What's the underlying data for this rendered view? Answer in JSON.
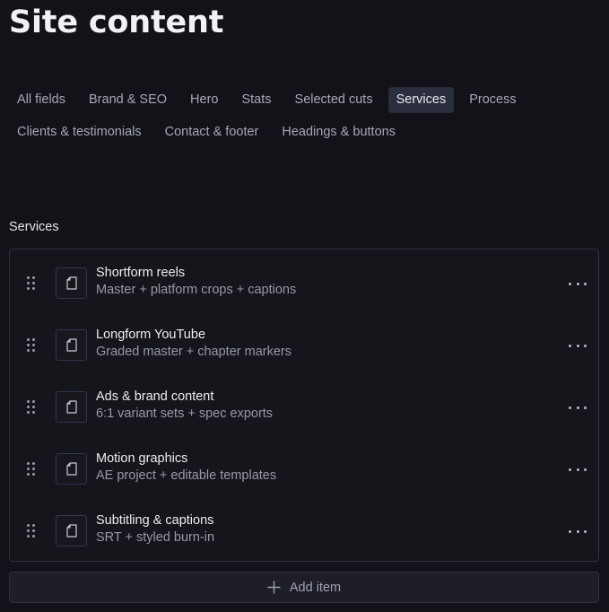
{
  "page": {
    "title": "Site content"
  },
  "tabs": [
    {
      "label": "All fields"
    },
    {
      "label": "Brand & SEO"
    },
    {
      "label": "Hero"
    },
    {
      "label": "Stats"
    },
    {
      "label": "Selected cuts"
    },
    {
      "label": "Services",
      "active": true
    },
    {
      "label": "Process"
    },
    {
      "label": "Clients & testimonials"
    },
    {
      "label": "Contact & footer"
    },
    {
      "label": "Headings & buttons"
    }
  ],
  "section": {
    "label": "Services"
  },
  "items": [
    {
      "title": "Shortform reels",
      "subtitle": "Master + platform crops + captions"
    },
    {
      "title": "Longform YouTube",
      "subtitle": "Graded master + chapter markers"
    },
    {
      "title": "Ads & brand content",
      "subtitle": "6:1 variant sets + spec exports"
    },
    {
      "title": "Motion graphics",
      "subtitle": "AE project + editable templates"
    },
    {
      "title": "Subtitling & captions",
      "subtitle": "SRT + styled burn-in"
    }
  ],
  "add_button": {
    "label": "Add item",
    "icon": "plus-icon"
  },
  "icons": {
    "drag": "drag-handle-icon",
    "thumb": "document-icon",
    "more": "more-horizontal-icon"
  },
  "colors": {
    "background": "#121218",
    "active_tab_bg": "#2b2e3d",
    "border": "#2f3240",
    "text_primary": "#ececf1",
    "text_secondary": "#9799a8"
  }
}
